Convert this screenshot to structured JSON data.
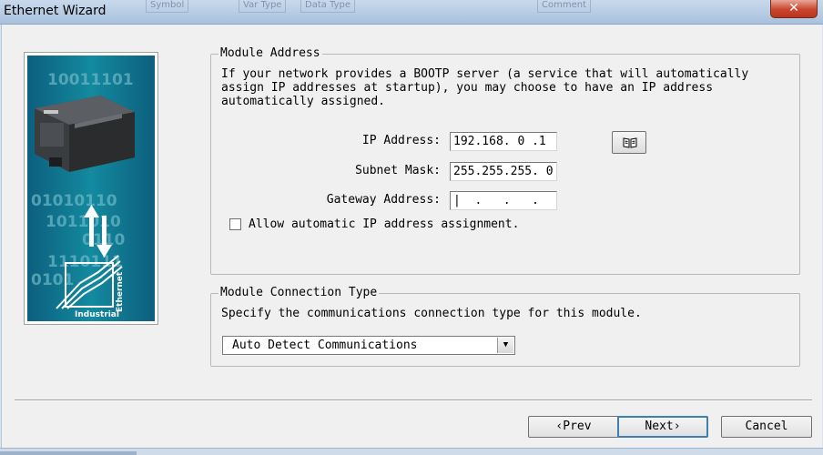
{
  "window": {
    "title": "Ethernet Wizard",
    "background_tabs": [
      "Symbol",
      "Var Type",
      "Data Type",
      "Comment"
    ],
    "close_glyph": "✕"
  },
  "module_address": {
    "legend": "Module Address",
    "description": "If your network provides a BOOTP server (a service that will automatically\nassign IP addresses at startup), you may choose to have an IP address\nautomatically assigned.",
    "ip_label": "IP Address:",
    "ip_value": "192.168. 0 .1",
    "subnet_label": "Subnet Mask:",
    "subnet_value": "255.255.255. 0",
    "gateway_label": "Gateway Address:",
    "gateway_value": "|  .   .   .",
    "bootp_checkbox_label": "Allow automatic IP address assignment.",
    "bootp_checked": false,
    "book_icon": "book-icon"
  },
  "connection_type": {
    "legend": "Module Connection Type",
    "description": "Specify the communications connection type for this module.",
    "selected": "Auto Detect Communications"
  },
  "art": {
    "binary_text": [
      "10011101",
      "01010110",
      "1011010",
      "0110",
      "1110111",
      "0101"
    ],
    "logo_industrial": "Industrial",
    "logo_ethernet": "Ethernet"
  },
  "buttons": {
    "prev": "‹Prev",
    "next": "Next›",
    "cancel": "Cancel"
  },
  "colors": {
    "accent_border": "#3c7fb1",
    "art_teal": "#0f6f86",
    "art_navy": "#123a5a"
  }
}
